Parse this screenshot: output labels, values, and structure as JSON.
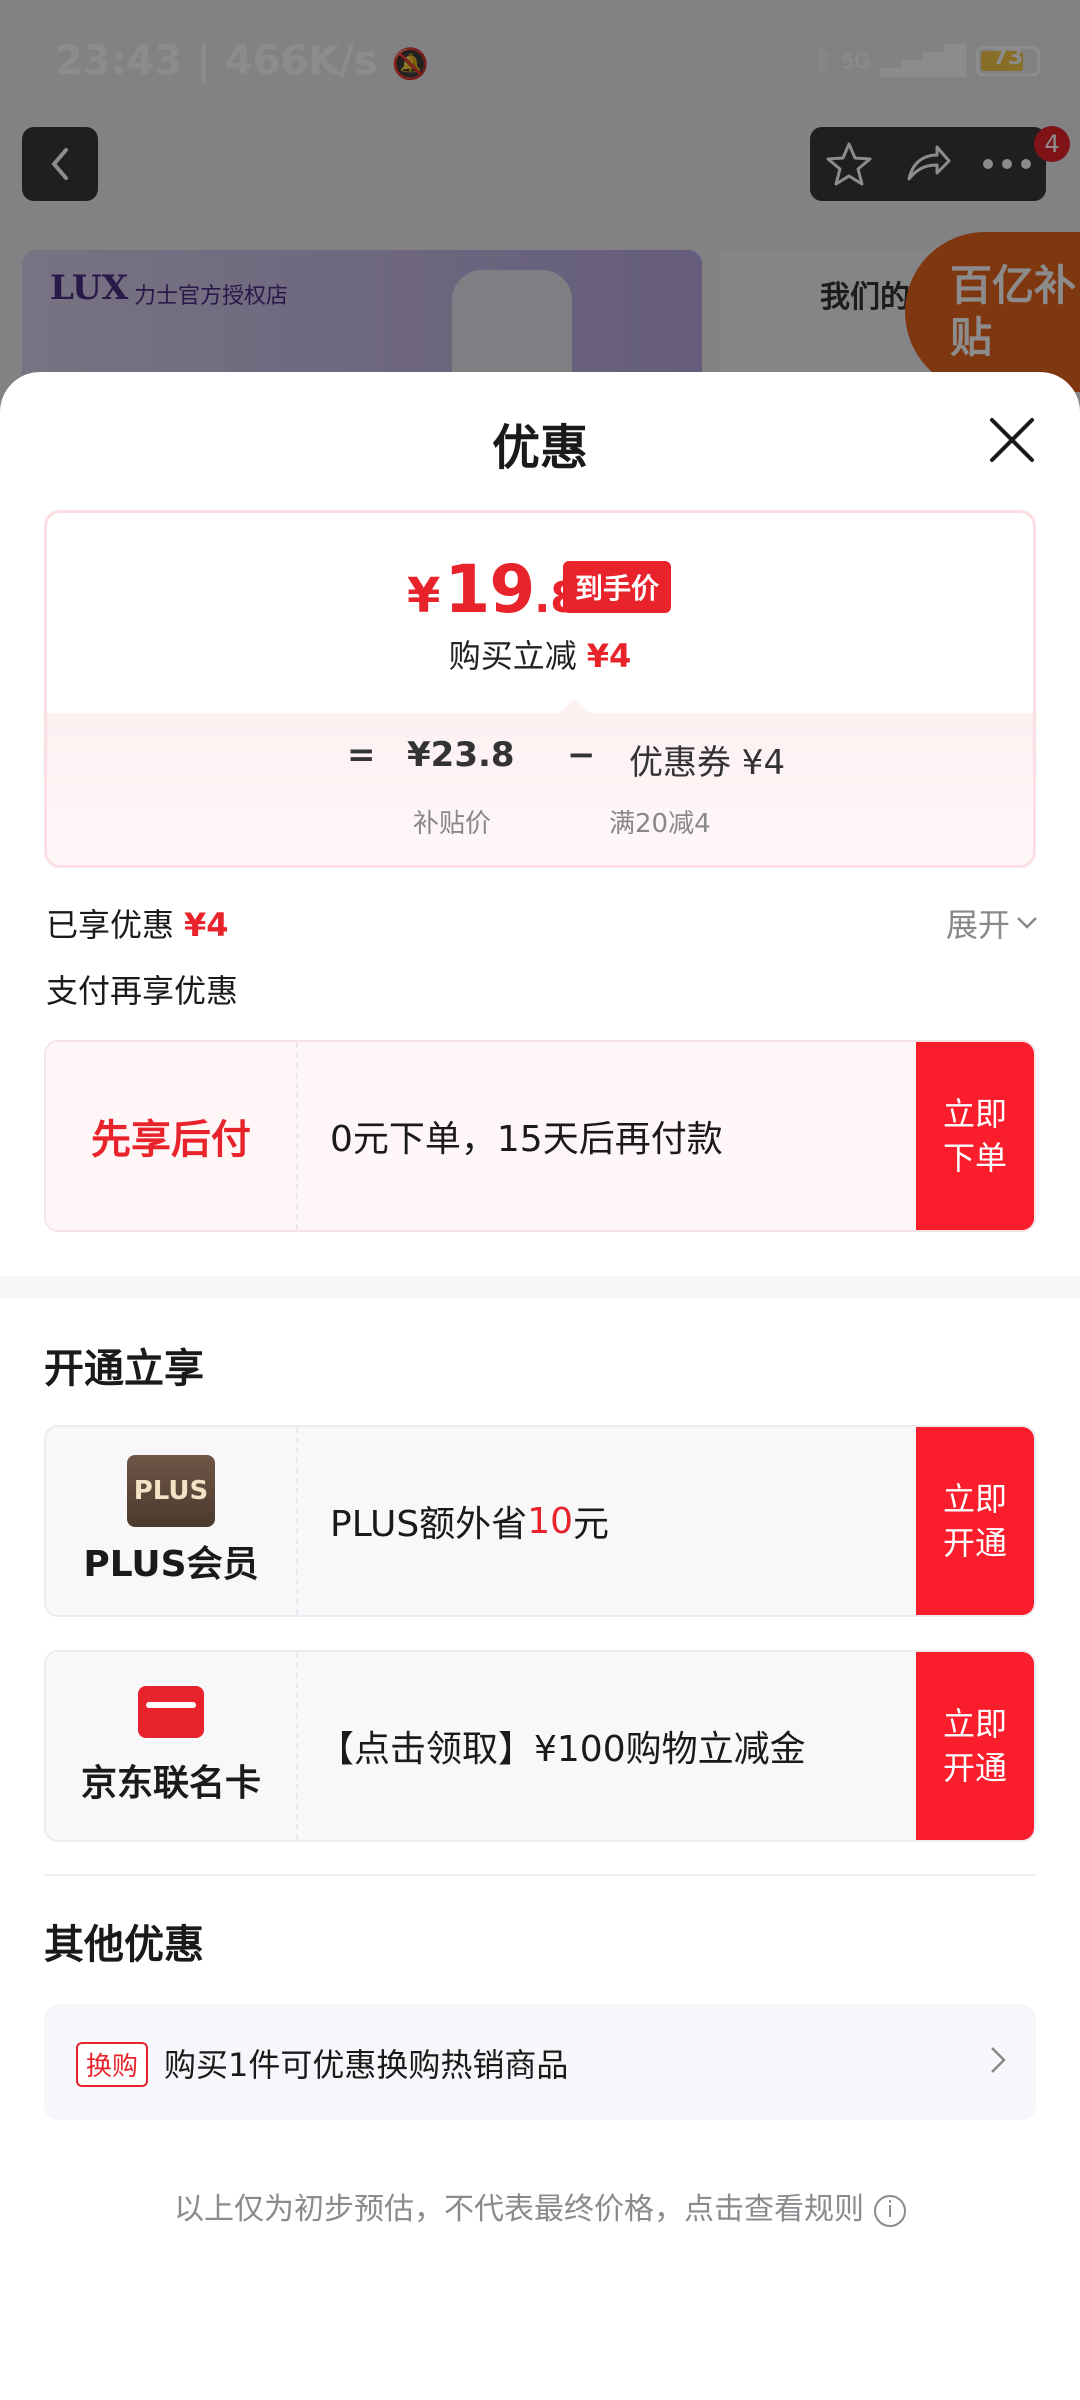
{
  "status_bar": {
    "time": "23:43",
    "speed": "466K/s",
    "battery": "73",
    "network": "5G"
  },
  "background_page": {
    "cart_badge": "4",
    "banner_brand": "LUX",
    "banner_store": "力士官方授权店",
    "banner_side_text": "我们的",
    "subsidy_text": "百亿补贴"
  },
  "sheet": {
    "title": "优惠"
  },
  "price_card": {
    "currency": "¥",
    "price_int": "19",
    "price_dec": ".8",
    "final_tag": "到手价",
    "reduce_label": "购买立减",
    "reduce_amount": "¥4",
    "equals": "=",
    "subsidy_price": "¥23.8",
    "minus": "−",
    "coupon_label": "优惠券 ¥4",
    "subsidy_price_label": "补贴价",
    "coupon_rule": "满20减4"
  },
  "enjoyed": {
    "label": "已享优惠",
    "amount": "¥4",
    "expand_label": "展开"
  },
  "pay_more": {
    "label": "支付再享优惠"
  },
  "pay_later": {
    "title": "先享后付",
    "text": "0元下单，15天后再付款",
    "button": "立即下单"
  },
  "membership": {
    "section_title": "开通立享",
    "plus": {
      "logo_text": "PLUS",
      "label": "PLUS会员",
      "text_before": "PLUS额外省",
      "text_highlight": "10",
      "text_after": "元",
      "button": "立即开通"
    },
    "card": {
      "label": "京东联名卡",
      "text": "【点击领取】¥100购物立减金",
      "button": "立即开通"
    }
  },
  "other": {
    "section_title": "其他优惠",
    "tag": "换购",
    "text": "购买1件可优惠换购热销商品"
  },
  "footer": {
    "note": "以上仅为初步预估，不代表最终价格，点击查看规则"
  },
  "colors": {
    "accent": "#e8232b",
    "button": "#fa1e2d",
    "muted": "#8a8a8f"
  }
}
